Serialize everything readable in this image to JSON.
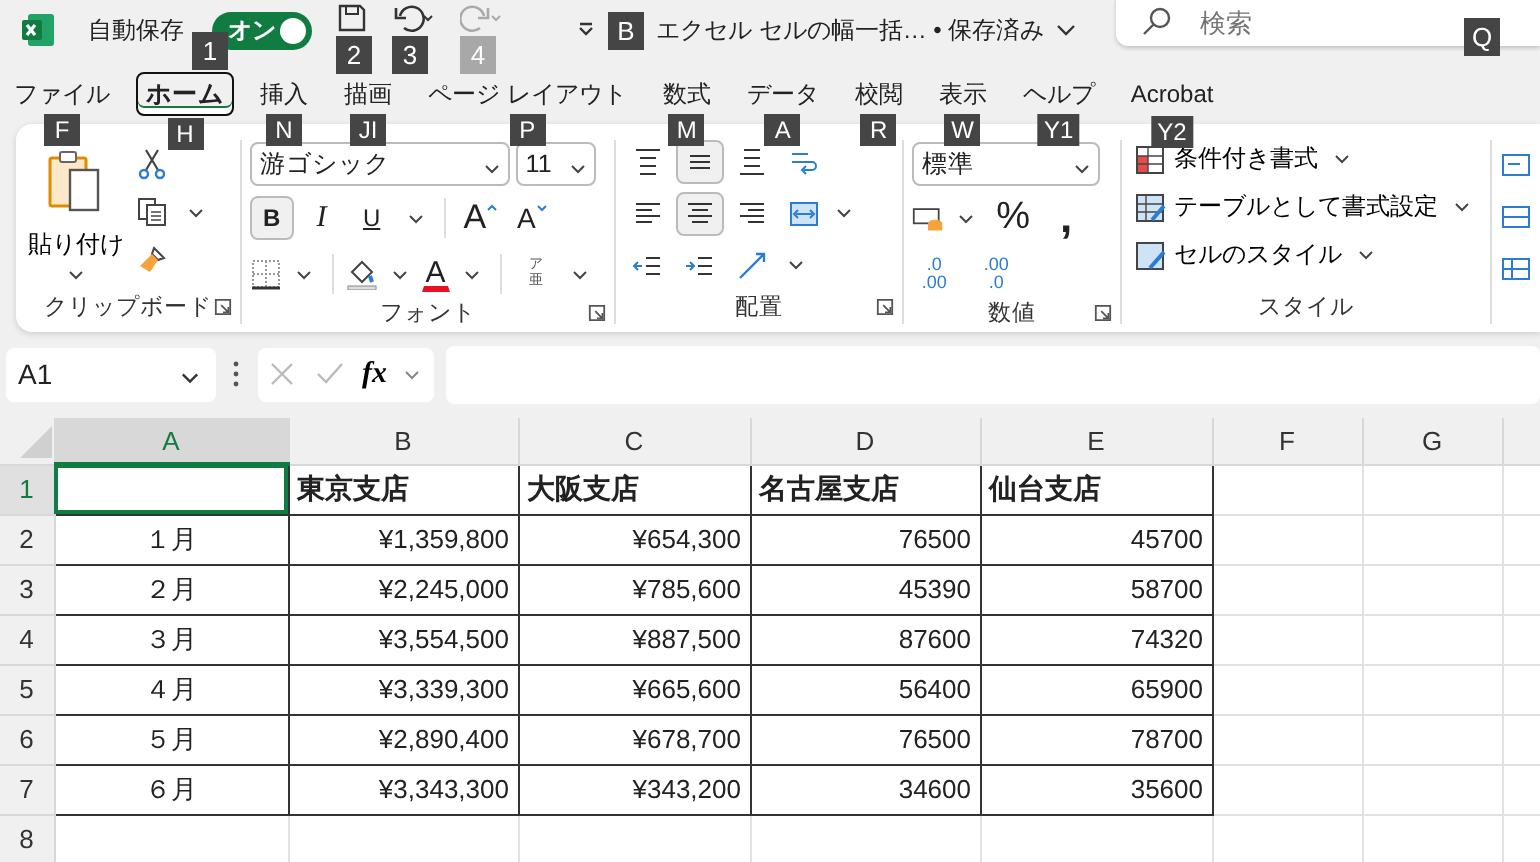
{
  "title_bar": {
    "autosave_label": "自動保存",
    "autosave": {
      "label": "オン",
      "on": true,
      "keytip": "1"
    },
    "quick_access": [
      {
        "kind": "save",
        "keytip": "2",
        "disabled": false
      },
      {
        "kind": "undo",
        "keytip": "3",
        "disabled": false
      },
      {
        "kind": "redo",
        "keytip": "4",
        "disabled": true
      }
    ],
    "customize_keytip": "B",
    "document_title": "エクセル  セルの幅一括… • 保存済み",
    "search": {
      "placeholder": "検索",
      "keytip": "Q"
    }
  },
  "tabs": [
    {
      "label": "ファイル",
      "selected": false,
      "keytip": "F"
    },
    {
      "label": "ホーム",
      "selected": true,
      "keytip": "H"
    },
    {
      "label": "挿入",
      "selected": false,
      "keytip": "N"
    },
    {
      "label": "描画",
      "selected": false,
      "keytip": "JI"
    },
    {
      "label": "ページ レイアウト",
      "selected": false,
      "keytip": "P"
    },
    {
      "label": "数式",
      "selected": false,
      "keytip": "M"
    },
    {
      "label": "データ",
      "selected": false,
      "keytip": "A"
    },
    {
      "label": "校閲",
      "selected": false,
      "keytip": "R"
    },
    {
      "label": "表示",
      "selected": false,
      "keytip": "W"
    },
    {
      "label": "ヘルプ",
      "selected": false,
      "keytip": "Y1"
    },
    {
      "label": "Acrobat",
      "selected": false,
      "keytip": "Y2"
    }
  ],
  "ribbon": {
    "clipboard": {
      "label": "クリップボード",
      "paste": "貼り付け"
    },
    "font": {
      "label": "フォント",
      "name": "游ゴシック",
      "size": "11",
      "bold": {
        "text": "B",
        "pressed": true
      },
      "italic": "I",
      "underline": "U",
      "grow": "A",
      "shrink": "A",
      "color_letter": "A",
      "phonetic_top": "ア",
      "phonetic_bottom": "亜"
    },
    "alignment": {
      "label": "配置",
      "buttons": [
        {
          "kind": "top",
          "pressed": false
        },
        {
          "kind": "middle",
          "pressed": true
        },
        {
          "kind": "bottom",
          "pressed": false
        },
        {
          "kind": "wrap",
          "pressed": false
        },
        {
          "kind": "left",
          "pressed": false
        },
        {
          "kind": "center",
          "pressed": true
        },
        {
          "kind": "right",
          "pressed": false
        },
        {
          "kind": "merge",
          "pressed": false
        },
        {
          "kind": "outdent",
          "pressed": false
        },
        {
          "kind": "indent",
          "pressed": false
        },
        {
          "kind": "orientation",
          "pressed": false
        }
      ]
    },
    "number": {
      "label": "数値",
      "format": "標準",
      "percent": "%",
      "comma": ",",
      "increase_decimal": [
        ".0",
        ".00"
      ],
      "decrease_decimal": [
        ".00",
        ".0"
      ]
    },
    "styles": {
      "label": "スタイル",
      "items": [
        {
          "kind": "conditional",
          "label": "条件付き書式"
        },
        {
          "kind": "table",
          "label": "テーブルとして書式設定"
        },
        {
          "kind": "cell",
          "label": "セルのスタイル"
        }
      ]
    }
  },
  "formula_bar": {
    "name_box": "A1",
    "function_label": "fx"
  },
  "columns": [
    {
      "label": "A",
      "selected": true
    },
    {
      "label": "B",
      "selected": false
    },
    {
      "label": "C",
      "selected": false
    },
    {
      "label": "D",
      "selected": false
    },
    {
      "label": "E",
      "selected": false
    },
    {
      "label": "F",
      "selected": false
    },
    {
      "label": "G",
      "selected": false
    }
  ],
  "rows": [
    {
      "number": "1",
      "selected": true,
      "kind": "header",
      "values": [
        "東京支店",
        "大阪支店",
        "名古屋支店",
        "仙台支店"
      ]
    },
    {
      "number": "2",
      "selected": false,
      "kind": "data",
      "month": "１月",
      "values": [
        "¥1,359,800",
        "¥654,300",
        "76500",
        "45700"
      ]
    },
    {
      "number": "3",
      "selected": false,
      "kind": "data",
      "month": "２月",
      "values": [
        "¥2,245,000",
        "¥785,600",
        "45390",
        "58700"
      ]
    },
    {
      "number": "4",
      "selected": false,
      "kind": "data",
      "month": "３月",
      "values": [
        "¥3,554,500",
        "¥887,500",
        "87600",
        "74320"
      ]
    },
    {
      "number": "5",
      "selected": false,
      "kind": "data",
      "month": "４月",
      "values": [
        "¥3,339,300",
        "¥665,600",
        "56400",
        "65900"
      ]
    },
    {
      "number": "6",
      "selected": false,
      "kind": "data",
      "month": "５月",
      "values": [
        "¥2,890,400",
        "¥678,700",
        "76500",
        "78700"
      ]
    },
    {
      "number": "7",
      "selected": false,
      "kind": "data",
      "month": "６月",
      "values": [
        "¥3,343,300",
        "¥343,200",
        "34600",
        "35600"
      ]
    },
    {
      "number": "8",
      "selected": false,
      "kind": "blank"
    }
  ]
}
